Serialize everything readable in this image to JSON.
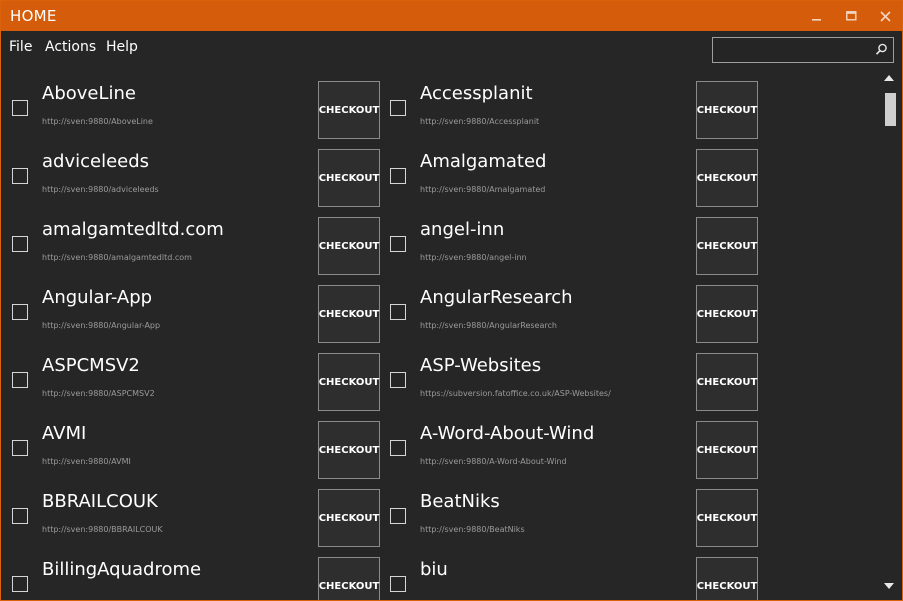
{
  "window": {
    "title": "HOME"
  },
  "menu": {
    "file": "File",
    "actions": "Actions",
    "help": "Help"
  },
  "search": {
    "value": "",
    "placeholder": ""
  },
  "checkout_label": "CHECKOUT",
  "colors": {
    "titlebar": "#d55c0b",
    "background": "#262626",
    "text": "#ffffff",
    "url": "#9a9a9a"
  },
  "repos": [
    {
      "name": "AboveLine",
      "url": "http://sven:9880/AboveLine"
    },
    {
      "name": "Accessplanit",
      "url": "http://sven:9880/Accessplanit"
    },
    {
      "name": "adviceleeds",
      "url": "http://sven:9880/adviceleeds"
    },
    {
      "name": "Amalgamated",
      "url": "http://sven:9880/Amalgamated"
    },
    {
      "name": "amalgamtedltd.com",
      "url": "http://sven:9880/amalgamtedltd.com"
    },
    {
      "name": "angel-inn",
      "url": "http://sven:9880/angel-inn"
    },
    {
      "name": "Angular-App",
      "url": "http://sven:9880/Angular-App"
    },
    {
      "name": "AngularResearch",
      "url": "http://sven:9880/AngularResearch"
    },
    {
      "name": "ASPCMSV2",
      "url": "http://sven:9880/ASPCMSV2"
    },
    {
      "name": "ASP-Websites",
      "url": "https://subversion.fatoffice.co.uk/ASP-Websites/"
    },
    {
      "name": "AVMI",
      "url": "http://sven:9880/AVMI"
    },
    {
      "name": "A-Word-About-Wind",
      "url": "http://sven:9880/A-Word-About-Wind"
    },
    {
      "name": "BBRAILCOUK",
      "url": "http://sven:9880/BBRAILCOUK"
    },
    {
      "name": "BeatNiks",
      "url": "http://sven:9880/BeatNiks"
    },
    {
      "name": "BillingAquadrome",
      "url": ""
    },
    {
      "name": "biu",
      "url": ""
    }
  ]
}
